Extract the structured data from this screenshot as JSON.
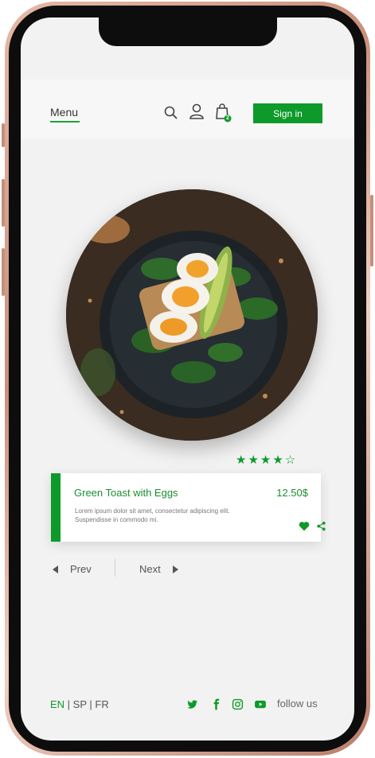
{
  "header": {
    "menu_label": "Menu",
    "cart_count": "2",
    "signin_label": "Sign in",
    "icons": [
      "search-icon",
      "user-icon",
      "shopping-bag-icon"
    ]
  },
  "product": {
    "title": "Green Toast with Eggs",
    "price": "12.50$",
    "description": "Lorem ipsum dolor sit amet, consectetur adipiscing elit. Suspendisse in commodo mi.",
    "rating": 4,
    "rating_max": 5
  },
  "pager": {
    "prev": "Prev",
    "next": "Next"
  },
  "footer": {
    "languages": [
      "EN",
      "SP",
      "FR"
    ],
    "active_language": "EN",
    "separator": " | ",
    "follow_label": "follow us",
    "social_icons": [
      "twitter-icon",
      "facebook-icon",
      "instagram-icon",
      "youtube-icon"
    ]
  },
  "colors": {
    "accent": "#0d9a2a",
    "background": "#f2f2f2"
  }
}
